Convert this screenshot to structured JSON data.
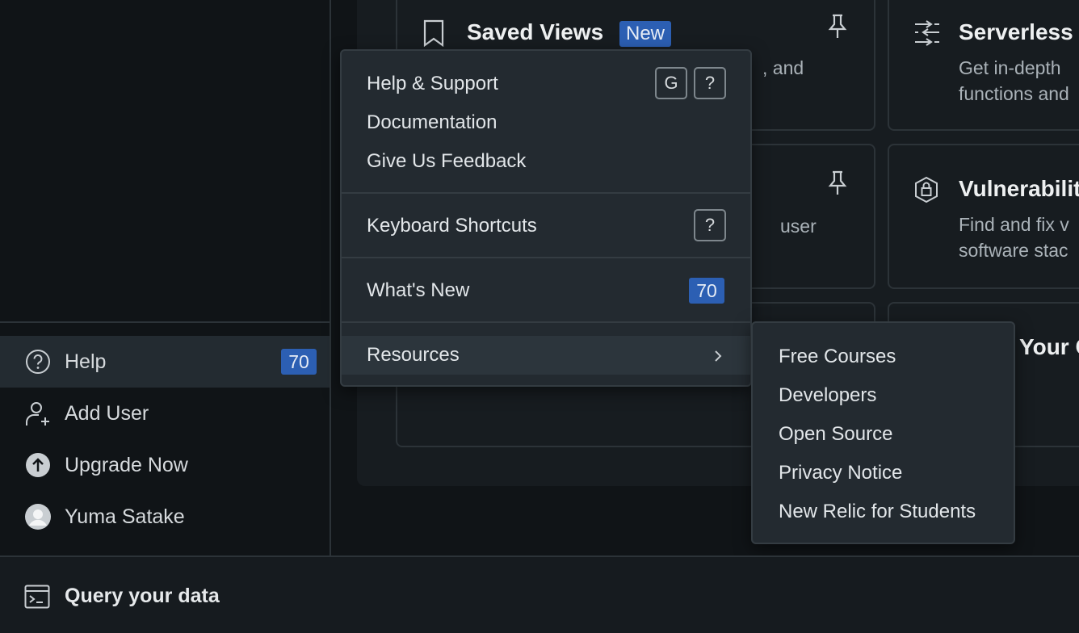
{
  "sidebar": {
    "items": [
      {
        "label": "Help",
        "icon": "help-circle-icon",
        "count": "70",
        "active": true
      },
      {
        "label": "Add User",
        "icon": "add-user-icon"
      },
      {
        "label": "Upgrade Now",
        "icon": "upgrade-arrow-icon"
      },
      {
        "label": "Yuma Satake",
        "icon": "avatar-icon"
      }
    ]
  },
  "bottom_bar": {
    "label": "Query your data",
    "icon": "terminal-icon"
  },
  "cards": [
    {
      "title": "Saved Views",
      "badge": "New",
      "desc_line1": ", and",
      "icon": "bookmark-icon",
      "pin_icon": "pin-icon"
    },
    {
      "title": "Serverless",
      "desc_line1": "Get in-depth",
      "desc_line2": "functions and",
      "icon": "serverless-icon"
    },
    {
      "desc_line1": "user",
      "pin_icon": "pin-icon"
    },
    {
      "title": "Vulnerabilit",
      "desc_line1": "Find and fix v",
      "desc_line2": "software stac",
      "icon": "shield-lock-icon"
    },
    {
      "title": "Your C"
    }
  ],
  "help_menu": {
    "items": [
      {
        "label": "Help & Support",
        "shortcut": [
          "G",
          "?"
        ]
      },
      {
        "label": "Documentation"
      },
      {
        "label": "Give Us Feedback"
      },
      {
        "label": "Keyboard Shortcuts",
        "shortcut": [
          "?"
        ]
      },
      {
        "label": "What's New",
        "count": "70"
      },
      {
        "label": "Resources",
        "icon": "chevron-right-icon"
      }
    ]
  },
  "resources_submenu": {
    "items": [
      "Free Courses",
      "Developers",
      "Open Source",
      "Privacy Notice",
      "New Relic for Students"
    ]
  },
  "colors": {
    "accent": "#2c5fb3",
    "background": "#101417",
    "menu": "#232a30"
  }
}
